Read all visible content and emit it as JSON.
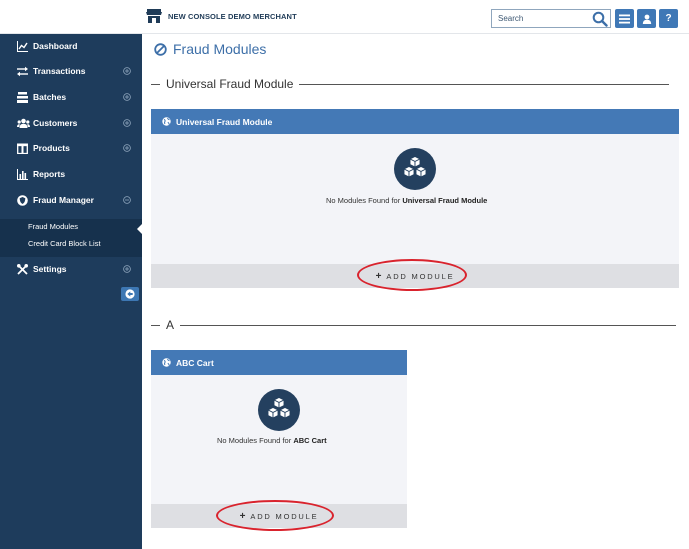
{
  "header": {
    "merchant_name": "NEW CONSOLE DEMO MERCHANT",
    "search_placeholder": "Search",
    "help_label": "?"
  },
  "sidebar": {
    "items": [
      {
        "label": "Dashboard",
        "icon": "chart-icon",
        "expandable": false
      },
      {
        "label": "Transactions",
        "icon": "transfer-arrows-icon",
        "expandable": true
      },
      {
        "label": "Batches",
        "icon": "stack-icon",
        "expandable": true
      },
      {
        "label": "Customers",
        "icon": "users-icon",
        "expandable": true
      },
      {
        "label": "Products",
        "icon": "box-icon",
        "expandable": true
      },
      {
        "label": "Reports",
        "icon": "bar-chart-icon",
        "expandable": false
      },
      {
        "label": "Fraud Manager",
        "icon": "shield-icon",
        "expandable": true,
        "expanded": true
      },
      {
        "label": "Settings",
        "icon": "tools-icon",
        "expandable": true
      }
    ],
    "subitems": [
      {
        "label": "Fraud Modules",
        "active": true
      },
      {
        "label": "Credit Card Block List",
        "active": false
      }
    ]
  },
  "main": {
    "page_title": "Fraud Modules",
    "sections": [
      {
        "heading": "Universal Fraud Module",
        "card": {
          "title": "Universal Fraud Module",
          "empty_prefix": "No Modules Found for",
          "empty_name": "Universal Fraud Module",
          "add_label": "ADD MODULE"
        }
      },
      {
        "heading": "A",
        "card": {
          "title": "ABC Cart",
          "empty_prefix": "No Modules Found for",
          "empty_name": "ABC Cart",
          "add_label": "ADD MODULE"
        }
      }
    ]
  },
  "colors": {
    "sidebar_bg": "#1e3c5c",
    "accent_blue": "#4479b6",
    "highlight_red": "#d9232d"
  }
}
